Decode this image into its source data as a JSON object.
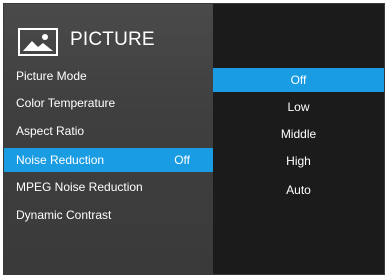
{
  "header": {
    "title": "PICTURE",
    "icon": "picture-icon"
  },
  "menu": {
    "items": [
      {
        "label": "Picture Mode",
        "value": ""
      },
      {
        "label": "Color Temperature",
        "value": ""
      },
      {
        "label": "Aspect Ratio",
        "value": ""
      },
      {
        "label": "Noise Reduction",
        "value": "Off"
      },
      {
        "label": "MPEG Noise Reduction",
        "value": ""
      },
      {
        "label": "Dynamic Contrast",
        "value": ""
      }
    ],
    "selected_index": 3
  },
  "options": {
    "items": [
      "Off",
      "Low",
      "Middle",
      "High",
      "Auto"
    ],
    "selected_index": 0
  },
  "colors": {
    "accent": "#1a9ce3",
    "panel_left": "#424242",
    "panel_right": "#1b1b1b",
    "text": "#ffffff"
  }
}
